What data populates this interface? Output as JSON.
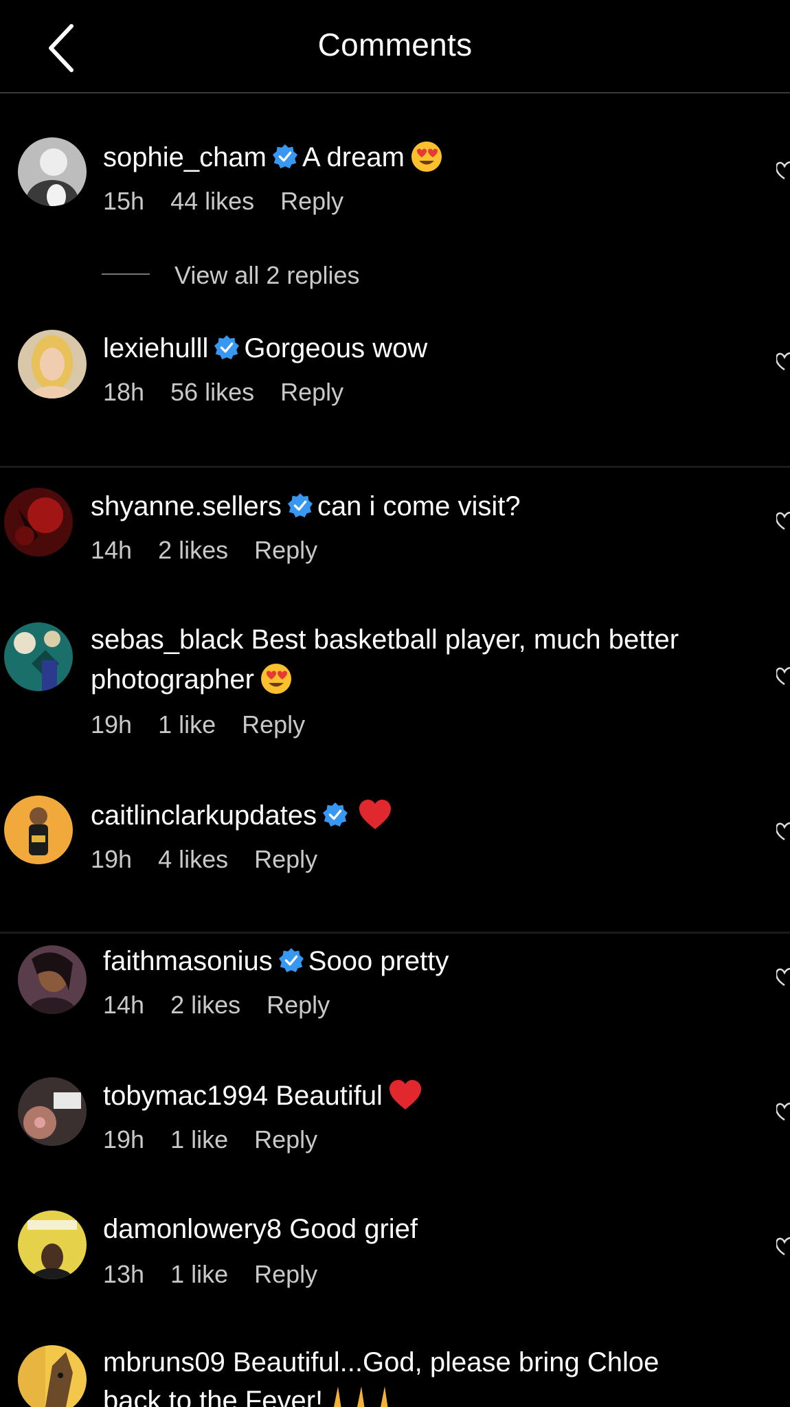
{
  "header": {
    "title": "Comments"
  },
  "view_replies": "View all 2 replies",
  "comments": [
    {
      "username": "sophie_cham",
      "verified": true,
      "text": "A dream",
      "emoji": "heart-eyes",
      "time": "15h",
      "likes": "44 likes",
      "reply": "Reply"
    },
    {
      "username": "lexiehulll",
      "verified": true,
      "text": "Gorgeous wow",
      "time": "18h",
      "likes": "56 likes",
      "reply": "Reply"
    },
    {
      "username": "shyanne.sellers",
      "verified": true,
      "text": "can i come visit?",
      "time": "14h",
      "likes": "2 likes",
      "reply": "Reply"
    },
    {
      "username": "sebas_black",
      "verified": false,
      "text": "Best basketball player, much better",
      "text2": "photographer",
      "emoji": "heart-eyes",
      "time": "19h",
      "likes": "1 like",
      "reply": "Reply"
    },
    {
      "username": "caitlinclarkupdates",
      "verified": true,
      "text": "",
      "emoji": "red-heart",
      "time": "19h",
      "likes": "4 likes",
      "reply": "Reply"
    },
    {
      "username": "faithmasonius",
      "verified": true,
      "text": "Sooo pretty",
      "time": "14h",
      "likes": "2 likes",
      "reply": "Reply"
    },
    {
      "username": "tobymac1994",
      "verified": false,
      "text": "Beautiful",
      "emoji": "red-heart",
      "time": "19h",
      "likes": "1 like",
      "reply": "Reply"
    },
    {
      "username": "damonlowery8",
      "verified": false,
      "text": "Good grief",
      "time": "13h",
      "likes": "1 like",
      "reply": "Reply"
    },
    {
      "username": "mbruns09",
      "verified": false,
      "text": "Beautiful...God, please bring Chloe",
      "text2": "back to the Fever!",
      "emoji": "folded-hands",
      "time": "",
      "likes": "",
      "reply": ""
    }
  ],
  "colors": {
    "background": "#000000",
    "verified": "#3897f0",
    "meta_text": "#c9c9c9"
  }
}
